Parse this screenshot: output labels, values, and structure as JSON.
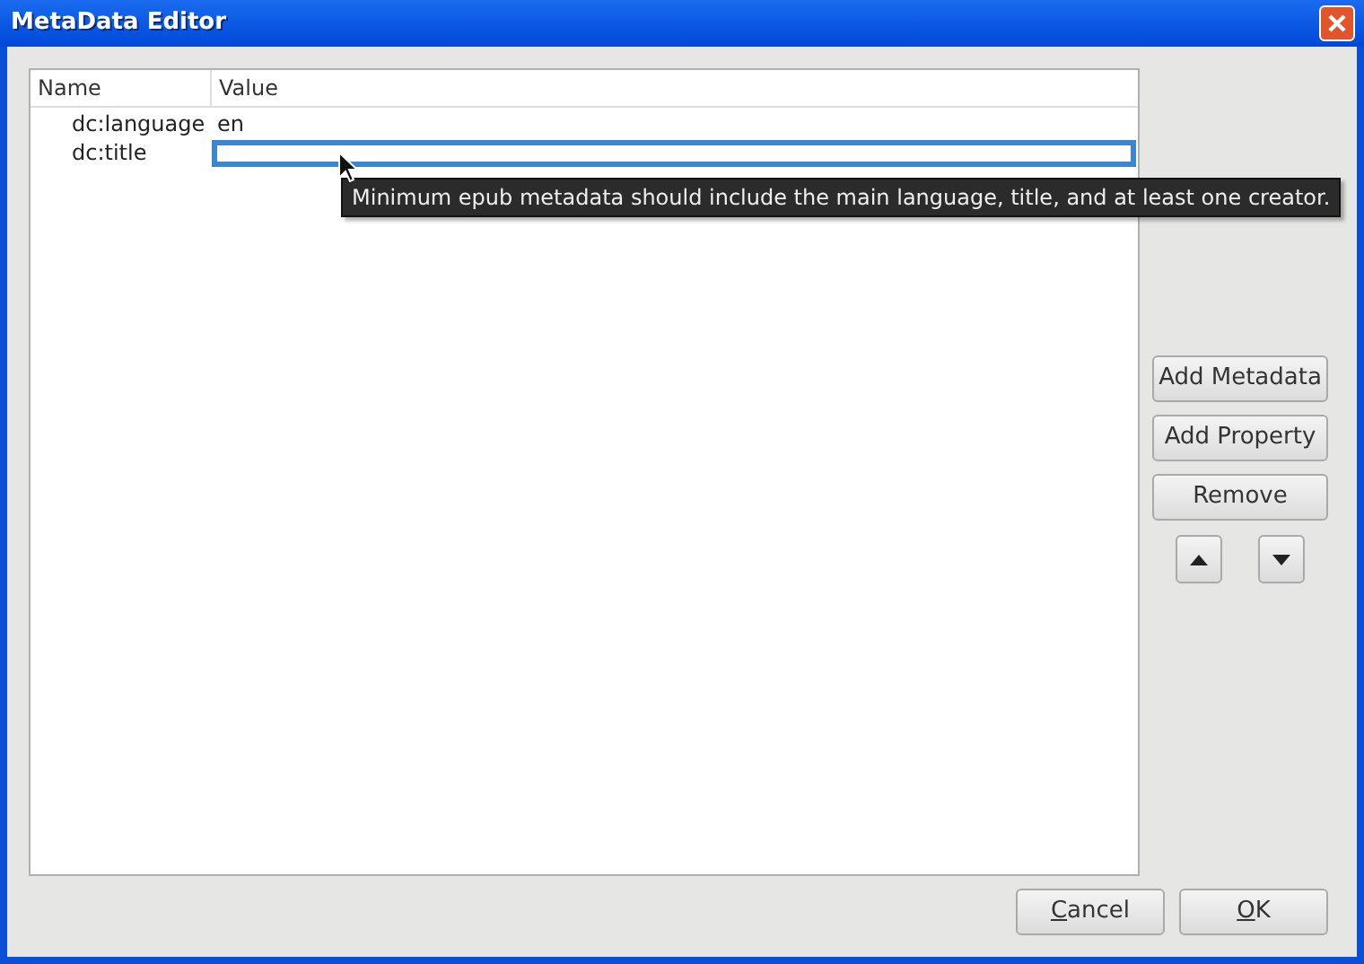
{
  "window": {
    "title": "MetaData Editor"
  },
  "table": {
    "columns": [
      "Name",
      "Value"
    ],
    "rows": [
      {
        "name": "dc:language",
        "value": "en",
        "editing": false
      },
      {
        "name": "dc:title",
        "value": "",
        "editing": true
      }
    ]
  },
  "tooltip": "Minimum epub metadata should include the main language, title, and at least one creator.",
  "side_buttons": [
    {
      "kind": "text",
      "label": "Add Metadata"
    },
    {
      "kind": "text",
      "label": "Add Property"
    },
    {
      "kind": "text",
      "label": "Remove"
    }
  ],
  "arrow_buttons": [
    {
      "kind": "up"
    },
    {
      "kind": "down"
    }
  ],
  "dialog_buttons": [
    {
      "label": "Cancel",
      "mnemonic_underlined": true
    },
    {
      "label": "OK",
      "mnemonic_underlined": true
    }
  ]
}
